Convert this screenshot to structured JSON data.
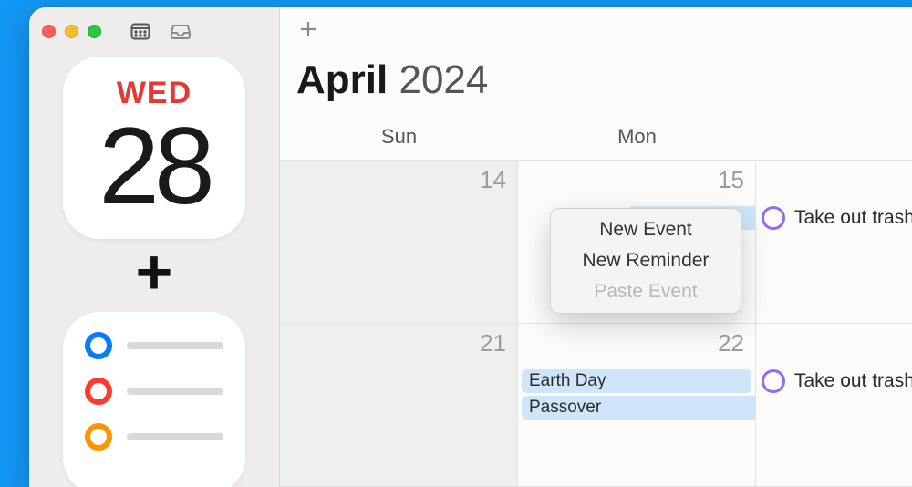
{
  "sidebar": {
    "calendar_tile": {
      "dow": "WED",
      "day": "28"
    },
    "plus": "+"
  },
  "header": {
    "month": "April",
    "year": "2024"
  },
  "day_headers": [
    "Sun",
    "Mon",
    ""
  ],
  "weeks": [
    {
      "sun": "14",
      "mon": "15",
      "tue_reminder": "Take out trash"
    },
    {
      "sun": "21",
      "mon": "22",
      "mon_events": [
        "Earth Day",
        "Passover"
      ],
      "tue_reminder": "Take out trash"
    }
  ],
  "context_menu": {
    "new_event": "New Event",
    "new_reminder": "New Reminder",
    "paste_event": "Paste Event"
  }
}
